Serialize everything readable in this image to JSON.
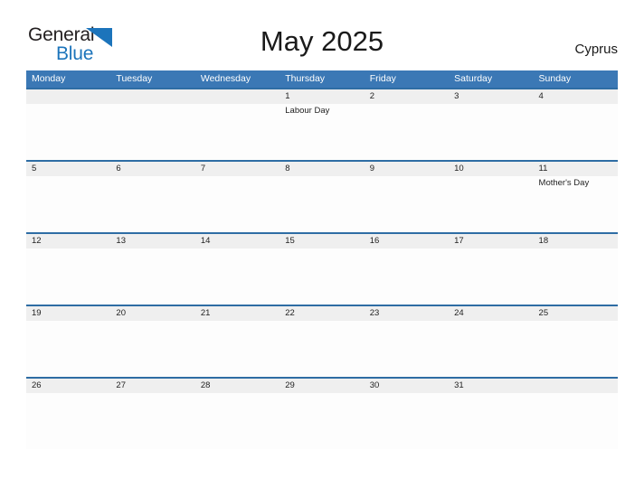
{
  "brand": {
    "word_one": "General",
    "word_two": "Blue",
    "triangle_icon": "triangle-icon",
    "color_dark": "#231f20",
    "color_blue": "#1c74bb"
  },
  "header": {
    "title": "May 2025",
    "region": "Cyprus"
  },
  "theme": {
    "header_bar": "#3b78b5",
    "row_rule": "#2e6da4",
    "date_band": "#efefef",
    "page_background": "#ffffff",
    "text": "#222222"
  },
  "calendar": {
    "day_headers": [
      "Monday",
      "Tuesday",
      "Wednesday",
      "Thursday",
      "Friday",
      "Saturday",
      "Sunday"
    ],
    "weeks": [
      {
        "days": [
          {
            "num": "",
            "event": ""
          },
          {
            "num": "",
            "event": ""
          },
          {
            "num": "",
            "event": ""
          },
          {
            "num": "1",
            "event": "Labour Day"
          },
          {
            "num": "2",
            "event": ""
          },
          {
            "num": "3",
            "event": ""
          },
          {
            "num": "4",
            "event": ""
          }
        ]
      },
      {
        "days": [
          {
            "num": "5",
            "event": ""
          },
          {
            "num": "6",
            "event": ""
          },
          {
            "num": "7",
            "event": ""
          },
          {
            "num": "8",
            "event": ""
          },
          {
            "num": "9",
            "event": ""
          },
          {
            "num": "10",
            "event": ""
          },
          {
            "num": "11",
            "event": "Mother's Day"
          }
        ]
      },
      {
        "days": [
          {
            "num": "12",
            "event": ""
          },
          {
            "num": "13",
            "event": ""
          },
          {
            "num": "14",
            "event": ""
          },
          {
            "num": "15",
            "event": ""
          },
          {
            "num": "16",
            "event": ""
          },
          {
            "num": "17",
            "event": ""
          },
          {
            "num": "18",
            "event": ""
          }
        ]
      },
      {
        "days": [
          {
            "num": "19",
            "event": ""
          },
          {
            "num": "20",
            "event": ""
          },
          {
            "num": "21",
            "event": ""
          },
          {
            "num": "22",
            "event": ""
          },
          {
            "num": "23",
            "event": ""
          },
          {
            "num": "24",
            "event": ""
          },
          {
            "num": "25",
            "event": ""
          }
        ]
      },
      {
        "days": [
          {
            "num": "26",
            "event": ""
          },
          {
            "num": "27",
            "event": ""
          },
          {
            "num": "28",
            "event": ""
          },
          {
            "num": "29",
            "event": ""
          },
          {
            "num": "30",
            "event": ""
          },
          {
            "num": "31",
            "event": ""
          },
          {
            "num": "",
            "event": ""
          }
        ]
      }
    ]
  }
}
